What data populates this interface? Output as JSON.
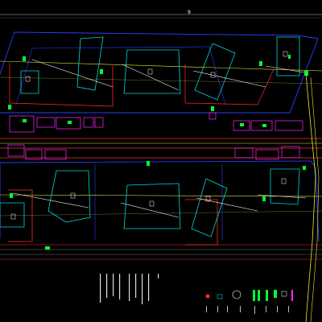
{
  "drawing": {
    "top_mark": "9",
    "notes": [
      "",
      "",
      "",
      "",
      "",
      "",
      "",
      "",
      "",
      ""
    ],
    "legend_items": [
      "",
      "",
      "",
      "",
      "",
      "",
      "",
      "",
      "",
      "",
      "",
      ""
    ]
  },
  "colors": {
    "background": "#000000",
    "block_outline": "#2a3bff",
    "building": "#00d8d8",
    "road": "#e8e830",
    "red_line": "#ff2a2a",
    "magenta": "#ff2aff",
    "green": "#00ff33",
    "white": "#ffffff"
  },
  "icons": [
    "north-arrow-icon",
    "legend-swatch-green",
    "legend-swatch-red"
  ]
}
